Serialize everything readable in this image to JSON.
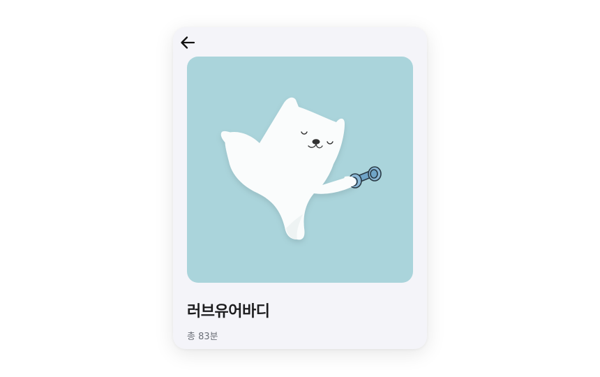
{
  "program": {
    "title": "러브유어바디",
    "duration": "총 83분"
  },
  "icons": {
    "back": "arrow-left-icon"
  },
  "colors": {
    "cover_background": "#aad4db",
    "card_background": "#f4f4f9",
    "title_text": "#1c1c1e",
    "subtitle_text": "#6b6f78",
    "dumbbell": "#6fa4c7"
  }
}
